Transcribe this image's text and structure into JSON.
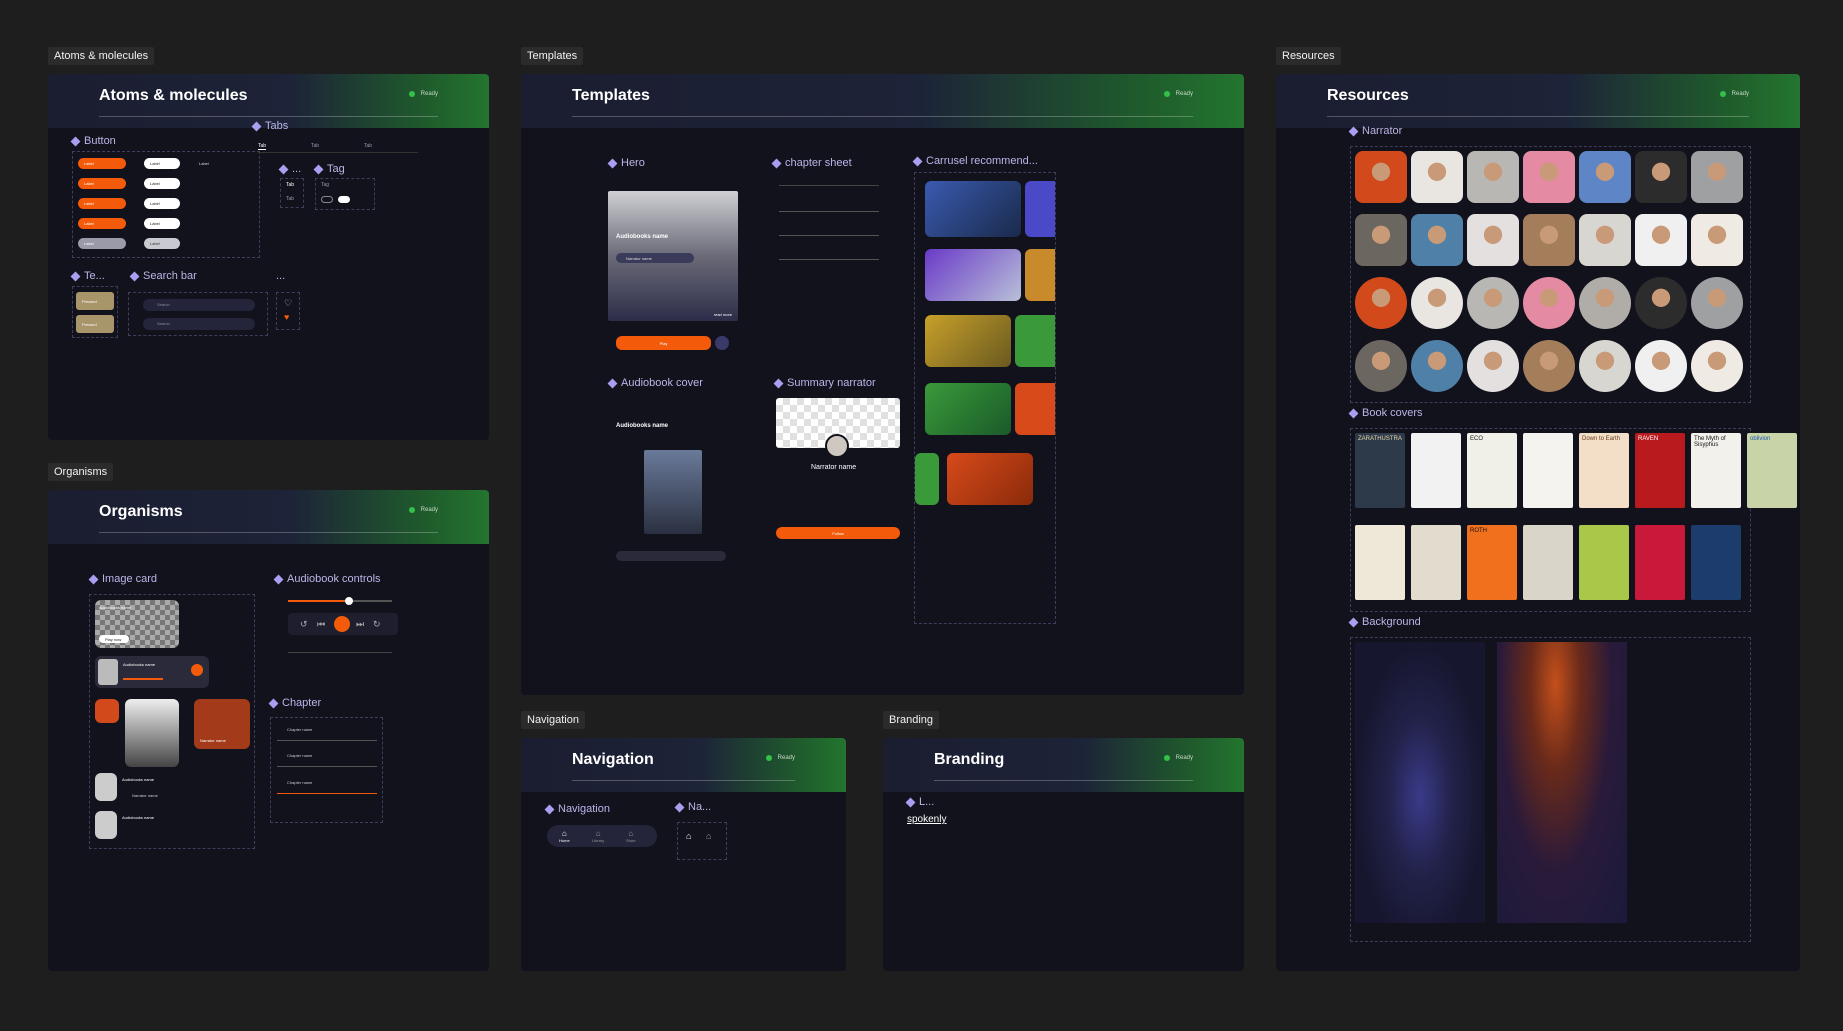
{
  "labels": {
    "atoms": "Atoms & molecules",
    "organisms": "Organisms",
    "templates": "Templates",
    "navigation": "Navigation",
    "branding": "Branding",
    "resources": "Resources"
  },
  "frames": {
    "atoms_title": "Atoms & molecules",
    "organisms_title": "Organisms",
    "templates_title": "Templates",
    "navigation_title": "Navigation",
    "branding_title": "Branding",
    "resources_title": "Resources",
    "status": "Ready"
  },
  "atoms": {
    "button": "Button",
    "tabs": "Tabs",
    "tab_item": "Tab",
    "tag": "Tag",
    "te": "Te...",
    "search_bar": "Search bar",
    "ellipsis": "...",
    "dots_label": "...",
    "button_label": "Label",
    "pressed": "Pressed",
    "search_placeholder": "Search"
  },
  "organisms": {
    "image_card": "Image card",
    "audiobook_controls": "Audiobook controls",
    "chapter": "Chapter",
    "audiobooks_name": "Audiobooks name",
    "narrator_name": "Narrator name",
    "chapter_name": "Chapter name",
    "play_now": "Play now"
  },
  "templates": {
    "hero": "Hero",
    "chapter_sheet": "chapter sheet",
    "carrusel": "Carrusel recommend...",
    "audiobook_cover": "Audiobook cover",
    "summary_narrator": "Summary narrator",
    "audiobooks_name": "Audiobooks name",
    "narrator_name": "Narrator name",
    "play": "Play",
    "follow": "Follow",
    "read_more": "read more"
  },
  "navigation": {
    "nav": "Navigation",
    "na": "Na...",
    "home": "Home",
    "library": "Library",
    "store": "Store"
  },
  "branding": {
    "l": "L...",
    "logo": "spokenly"
  },
  "resources": {
    "narrator": "Narrator",
    "book_covers": "Book covers",
    "background": "Background"
  },
  "covers": [
    {
      "title": "ZARATHUSTRA",
      "color": "#2d3a4a",
      "text": "#e8d7a8"
    },
    {
      "title": "",
      "color": "#f2f2f2",
      "text": "#111"
    },
    {
      "title": "ECO",
      "color": "#f0efe8",
      "text": "#222"
    },
    {
      "title": "",
      "color": "#f5f3ef",
      "text": "#333"
    },
    {
      "title": "Down to Earth",
      "color": "#f3dfc8",
      "text": "#6a3d1a"
    },
    {
      "title": "RAVEN",
      "color": "#b81a1e",
      "text": "#fff"
    },
    {
      "title": "The Myth of Sisyphus",
      "color": "#f3f1ec",
      "text": "#111"
    },
    {
      "title": "oblivion",
      "color": "#c9d3a8",
      "text": "#1e5aa8"
    },
    {
      "title": "",
      "color": "#efe8d8",
      "text": "#c42d14"
    },
    {
      "title": "",
      "color": "#e2dccf",
      "text": "#333"
    },
    {
      "title": "ROTH",
      "color": "#f0701e",
      "text": "#111"
    },
    {
      "title": "",
      "color": "#d9d5c8",
      "text": "#222"
    },
    {
      "title": "",
      "color": "#a9c84a",
      "text": "#222"
    },
    {
      "title": "",
      "color": "#c8193a",
      "text": "#fff"
    },
    {
      "title": "",
      "color": "#1d3c6e",
      "text": "#fff"
    }
  ],
  "faces": [
    "#d24a1c",
    "#e9e6e2",
    "#b9b7b4",
    "#e48aa2",
    "#5e86c6",
    "#2c2c2c",
    "#9fa0a2",
    "#6c6660",
    "#4f80a8",
    "#e4e0df",
    "#a47e5a",
    "#d8d6d0",
    "#f0f0f0",
    "#efeae4",
    "#d24a1c",
    "#e9e6e2",
    "#b9b7b4",
    "#e48aa2",
    "#b0aca8",
    "#2c2c2c",
    "#9fa0a2",
    "#6c6660",
    "#4f80a8",
    "#e4e0df",
    "#a47e5a",
    "#d8d6d0",
    "#f0f0f0",
    "#efeae4"
  ]
}
